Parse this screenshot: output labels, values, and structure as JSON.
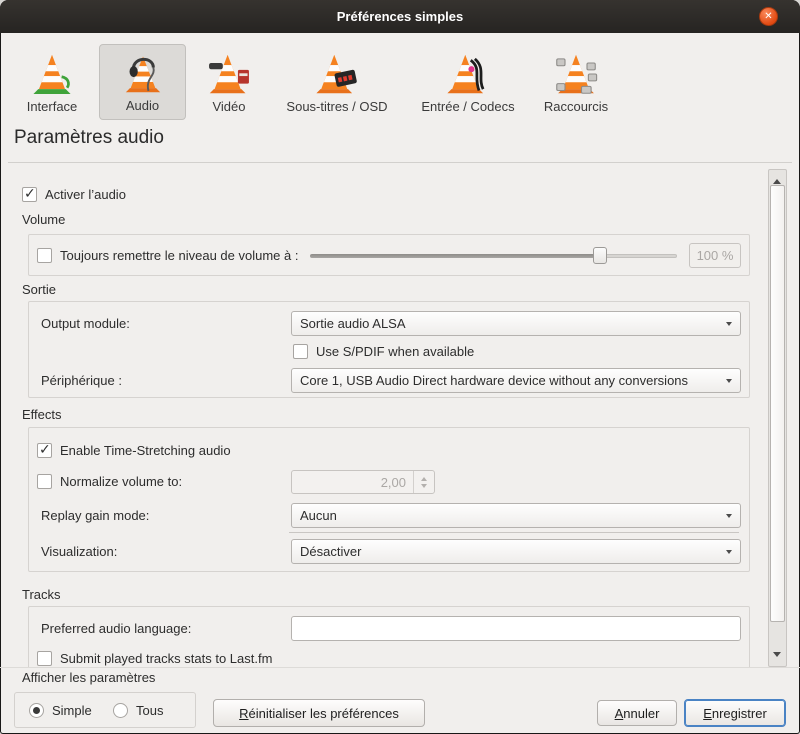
{
  "window": {
    "title": "Préférences simples",
    "close_glyph": "✕"
  },
  "toolbar": {
    "selected": "audio",
    "items": [
      {
        "id": "interface",
        "label": "Interface"
      },
      {
        "id": "audio",
        "label": "Audio"
      },
      {
        "id": "video",
        "label": "Vidéo"
      },
      {
        "id": "subtitles",
        "label": "Sous-titres / OSD"
      },
      {
        "id": "input_codecs",
        "label": "Entrée / Codecs"
      },
      {
        "id": "shortcuts",
        "label": "Raccourcis"
      }
    ]
  },
  "heading": "Paramètres audio",
  "audio_panel": {
    "enable_audio_label": "Activer l’audio",
    "enable_audio_checked": true,
    "volume_section": "Volume",
    "always_reset_volume_label": "Toujours remettre le niveau de volume à :",
    "always_reset_volume_checked": false,
    "volume_value": "100 %",
    "volume_slider_percent": 79,
    "output_section": "Sortie",
    "output_module_label": "Output module:",
    "output_module_value": "Sortie audio ALSA",
    "spdif_label": "Use S/PDIF when available",
    "spdif_checked": false,
    "device_label": "Périphérique :",
    "device_value": "Core 1, USB Audio Direct hardware device without any conversions",
    "effects_section": "Effects",
    "time_stretching_label": "Enable Time-Stretching audio",
    "time_stretching_checked": true,
    "normalize_label": "Normalize volume to:",
    "normalize_checked": false,
    "normalize_value": "2,00",
    "replay_gain_label": "Replay gain mode:",
    "replay_gain_value": "Aucun",
    "visualization_label": "Visualization:",
    "visualization_value": "Désactiver",
    "tracks_section": "Tracks",
    "preferred_language_label": "Preferred audio language:",
    "preferred_language_value": "",
    "lastfm_label": "Submit played tracks stats to Last.fm",
    "lastfm_checked": false
  },
  "footer": {
    "show_settings_label": "Afficher les paramètres",
    "simple_label": "Simple",
    "all_label": "Tous",
    "selected_mode": "Simple",
    "reset_button": "Réinitialiser les préférences",
    "cancel_button": "Annuler",
    "save_button": "Enregistrer"
  },
  "colors": {
    "titlebar": "#262422",
    "close_button": "#e95420",
    "focus_accent": "#4a83c4",
    "selected_tab_bg": "#dcdad7"
  }
}
